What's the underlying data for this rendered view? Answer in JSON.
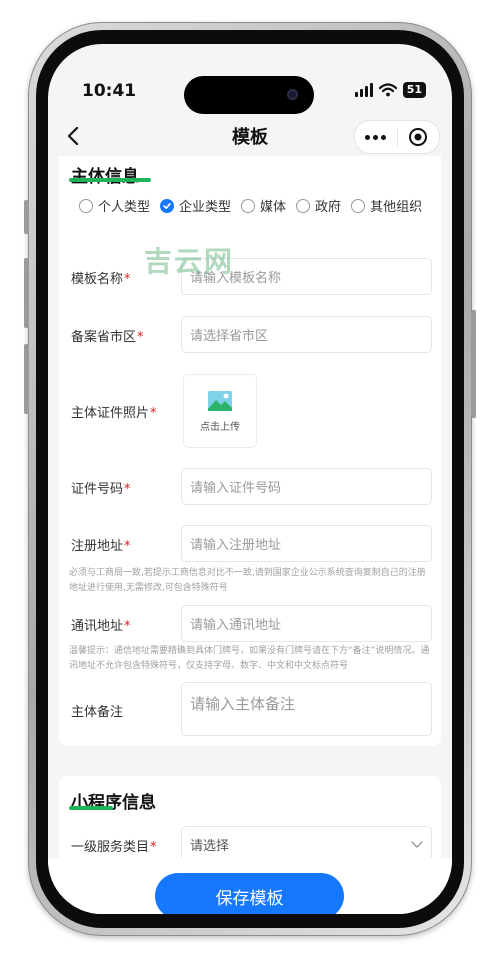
{
  "status": {
    "time": "10:41",
    "battery": "51"
  },
  "nav": {
    "title": "模板"
  },
  "subject": {
    "section_title": "主体信息",
    "radio_options": [
      {
        "label": "个人类型",
        "checked": false
      },
      {
        "label": "企业类型",
        "checked": true
      },
      {
        "label": "媒体",
        "checked": false
      },
      {
        "label": "政府",
        "checked": false
      },
      {
        "label": "其他组织",
        "checked": false
      }
    ],
    "template_name": {
      "label": "模板名称",
      "placeholder": "请输入模板名称"
    },
    "province": {
      "label": "备案省市区",
      "placeholder": "请选择省市区"
    },
    "id_photo": {
      "label": "主体证件照片",
      "upload_text": "点击上传"
    },
    "id_number": {
      "label": "证件号码",
      "placeholder": "请输入证件号码"
    },
    "reg_address": {
      "label": "注册地址",
      "placeholder": "请输入注册地址",
      "hint": "必须与工商局一致,若提示工商信息对比不一致,请到国家企业公示系统查询复制自己的注册地址进行使用,无需修改,可包含特殊符号"
    },
    "mail_address": {
      "label": "通讯地址",
      "placeholder": "请输入通讯地址",
      "hint": "温馨提示：通信地址需要精确到具体门牌号，如果没有门牌号请在下方“备注”说明情况。通讯地址不允许包含特殊符号，仅支持字母、数字、中文和中文标点符号"
    },
    "remark": {
      "label": "主体备注",
      "placeholder": "请输入主体备注"
    }
  },
  "miniapp": {
    "section_title": "小程序信息",
    "service_category": {
      "label": "一级服务类目",
      "placeholder": "请选择"
    }
  },
  "watermark": "吉云网",
  "save_label": "保存模板",
  "colors": {
    "accent": "#1677ff",
    "underline": "#1fb45a",
    "required": "#e02020"
  }
}
